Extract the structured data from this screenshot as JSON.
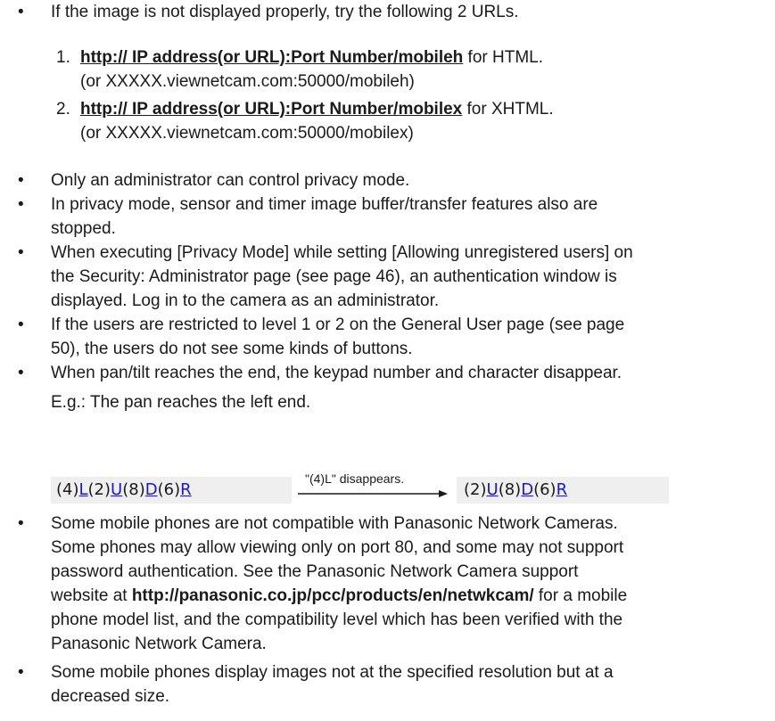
{
  "bullets": {
    "b1": "If the image is not displayed properly, try the following 2 URLs.",
    "url1": {
      "num": "1.",
      "link": "http:// IP address(or URL):Port Number/mobileh",
      "suffix": " for HTML.",
      "alt": "(or XXXXX.viewnetcam.com:50000/mobileh)"
    },
    "url2": {
      "num": "2.",
      "link": "http:// IP address(or URL):Port Number/mobilex",
      "suffix": " for XHTML.",
      "alt": "(or XXXXX.viewnetcam.com:50000/mobilex)"
    },
    "b2": "Only an administrator can control privacy mode.",
    "b3": [
      "In privacy mode, sensor and timer image buffer/transfer features also are",
      "stopped."
    ],
    "b4": [
      "When executing [Privacy Mode] while setting [Allowing unregistered users] on",
      "the Security: Administrator page (see page 46), an authentication window is",
      "displayed. Log in to the camera as an administrator."
    ],
    "b5": [
      "If the users are restricted to level 1 or 2 on the General User page (see page",
      "50), the users do not see some kinds of buttons."
    ],
    "b6": "When pan/tilt reaches the end, the keypad number and character disappear.",
    "b6_example": "E.g.: The pan reaches the left end.",
    "b7": {
      "lines": [
        "Some mobile phones are not compatible with Panasonic Network Cameras.",
        "Some phones may allow viewing only on port 80, and some may not support",
        "password authentication. See the Panasonic Network Camera support"
      ],
      "pre": "website at ",
      "link": "http://panasonic.co.jp/pcc/products/en/netwkcam/",
      "post": " for a mobile",
      "lines2": [
        "phone model list, and the compatibility level which has been verified with the",
        "Panasonic Network Camera."
      ]
    },
    "b8": [
      "Some mobile phones display images not at the specified resolution but at a",
      "decreased size."
    ]
  },
  "keypad_before": {
    "p1": "(4)",
    "l": "L",
    "p2": "(2)",
    "u": "U",
    "p3": "(8)",
    "d": "D",
    "p4": "(6)",
    "r": "R"
  },
  "arrow_label": "\"(4)L\" disappears.",
  "keypad_after": {
    "p2": "(2)",
    "u": "U",
    "p3": "(8)",
    "d": "D",
    "p4": "(6)",
    "r": "R"
  },
  "bullet_char": "•"
}
